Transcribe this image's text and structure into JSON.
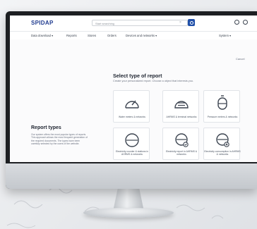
{
  "app": {
    "brand": "SPIDAP"
  },
  "header": {
    "search_placeholder": "Start searching"
  },
  "nav": {
    "items": [
      {
        "label": "Data download ▾"
      },
      {
        "label": "Reports"
      },
      {
        "label": "Stores"
      },
      {
        "label": "Orders"
      },
      {
        "label": "Devices and networks ▾"
      },
      {
        "label": "System ▾"
      }
    ]
  },
  "left_panel": {
    "title": "Report types",
    "description": "Our system offers the most popular types of reports. This approach allows the most frequent generation of the required documents. The types have been carefully selected by the users of the website."
  },
  "main": {
    "close_label": "Cancel",
    "title": "Select type of report",
    "subtitle": "Create your personalized report. Choose a object that interests you."
  },
  "cards": [
    {
      "label": "Water meters & networks",
      "icon": "water-meter-icon"
    },
    {
      "label": "AHRMS & terminal networks",
      "icon": "ahrms-icon"
    },
    {
      "label": "Pressure meters & networks",
      "icon": "pressure-meter-icon"
    },
    {
      "label": "Electricity counter & stations in AHRMS & networks",
      "icon": "electricity-counter-icon"
    },
    {
      "label": "Electricity report in AHRMS & networks",
      "icon": "electricity-report-icon"
    },
    {
      "label": "Electricity consumption in AHRMS & networks",
      "icon": "electricity-consumption-icon"
    }
  ],
  "colors": {
    "brand": "#1f3b8f",
    "accent": "#1f4fa8"
  }
}
